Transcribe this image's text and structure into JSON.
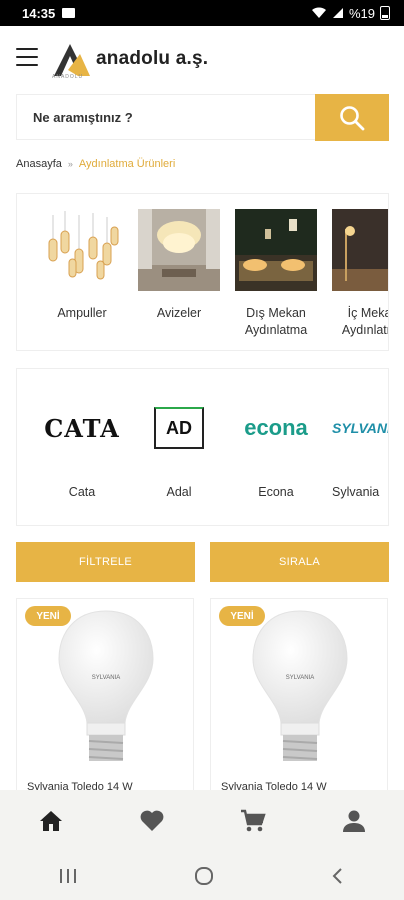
{
  "status_bar": {
    "time": "14:35",
    "battery": "%19"
  },
  "header": {
    "brand_name": "anadolu a.ş.",
    "brand_sub": "ANADOLU"
  },
  "search": {
    "placeholder": "Ne aramıştınız ?"
  },
  "breadcrumb": {
    "home": "Anasayfa",
    "separator": "»",
    "current": "Aydınlatma Ürünleri"
  },
  "categories": [
    {
      "label": "Ampuller"
    },
    {
      "label": "Avizeler"
    },
    {
      "label": "Dış Mekan Aydınlatma"
    },
    {
      "label": "İç Mekan Aydınlatma"
    }
  ],
  "brands": [
    {
      "label": "Cata",
      "logo_text": "CATA"
    },
    {
      "label": "Adal",
      "logo_text": "AD"
    },
    {
      "label": "Econa",
      "logo_text": "econa"
    },
    {
      "label": "Sylvania",
      "logo_text": "SYLVANIA"
    }
  ],
  "actions": {
    "filter_label": "FİLTRELE",
    "sort_label": "SIRALA"
  },
  "products": [
    {
      "badge": "YENİ",
      "name": "Sylvania Toledo 14 W"
    },
    {
      "badge": "YENİ",
      "name": "Sylvania Toledo 14 W"
    }
  ],
  "bottom_nav": [
    "home-icon",
    "heart-icon",
    "cart-icon",
    "user-icon"
  ],
  "colors": {
    "accent": "#e7b445",
    "breadcrumb_active": "#e0ab3a"
  }
}
